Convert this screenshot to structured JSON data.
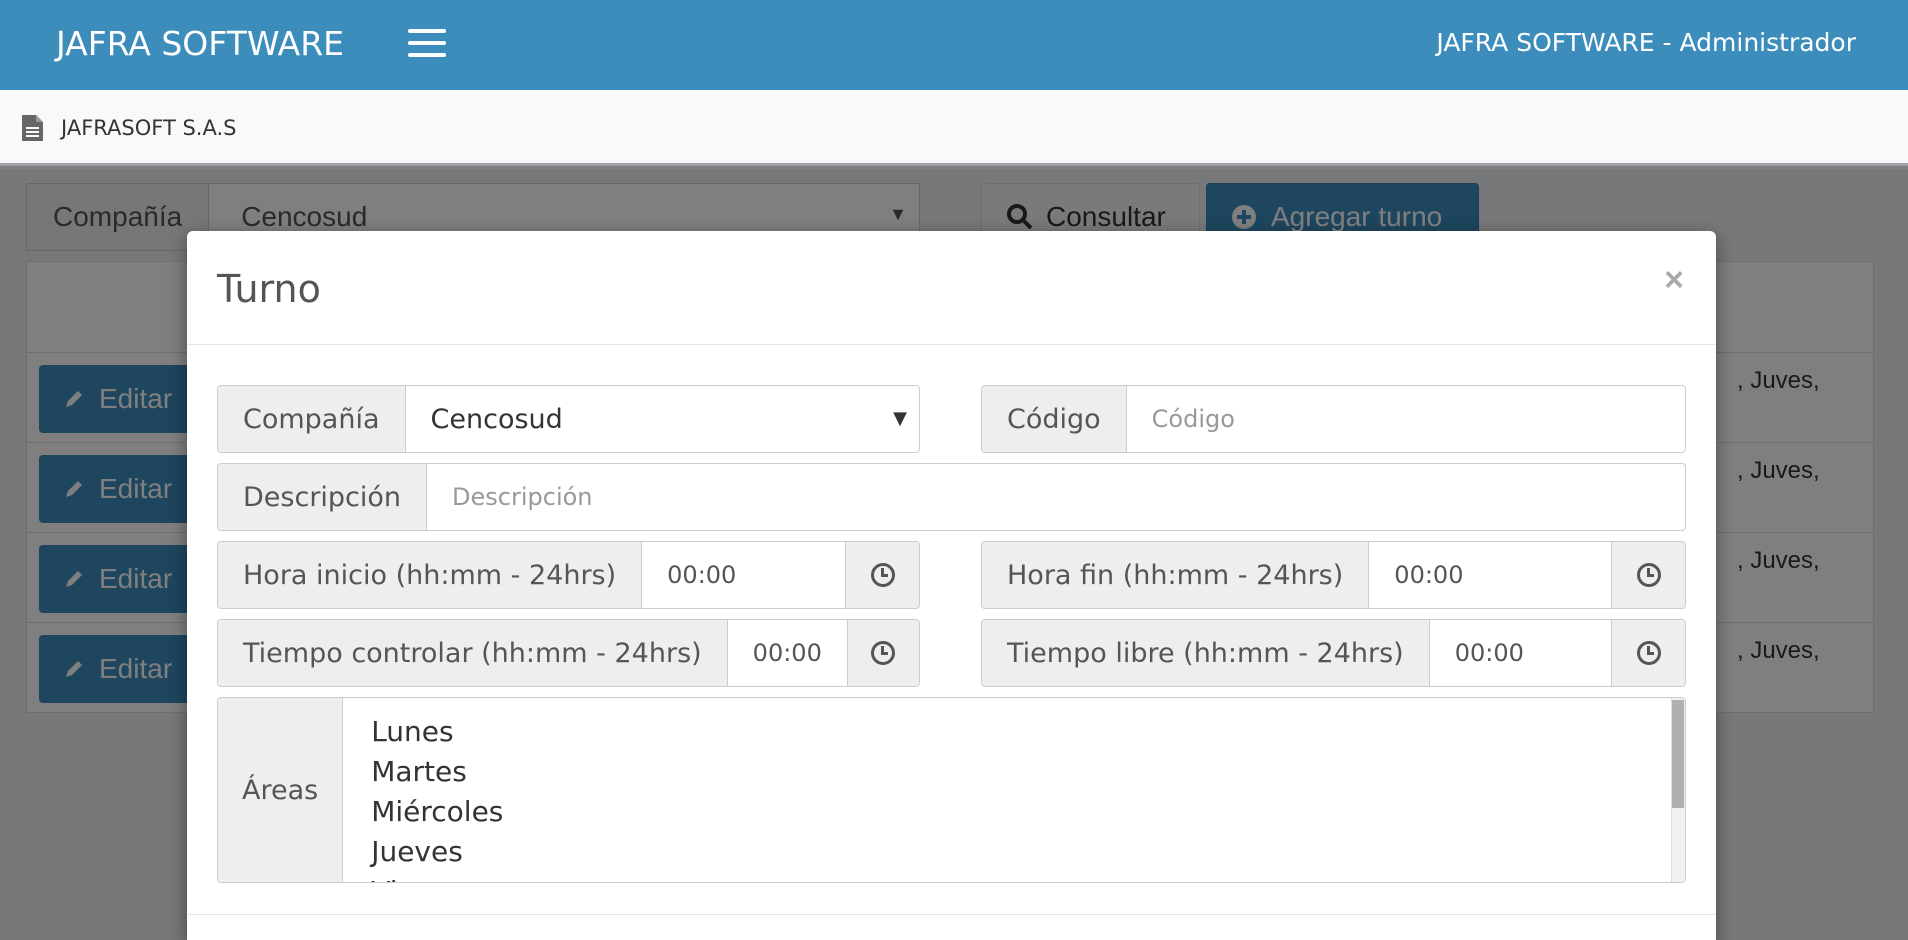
{
  "header": {
    "brand": "JAFRA SOFTWARE",
    "user_info": "JAFRA SOFTWARE  -  Administrador"
  },
  "subheader": {
    "company": "JAFRASOFT S.A.S"
  },
  "background": {
    "company_label": "Compañía",
    "company_value": "Cencosud",
    "consultar_label": "Consultar",
    "agregar_label": "Agregar turno",
    "rows": [
      {
        "edit_label": "Editar",
        "days": ", Juves,"
      },
      {
        "edit_label": "Editar",
        "days": ", Juves,"
      },
      {
        "edit_label": "Editar",
        "days": ", Juves,"
      },
      {
        "edit_label": "Editar",
        "days": ", Juves,"
      }
    ]
  },
  "modal": {
    "title": "Turno",
    "close": "×",
    "company_label": "Compañía",
    "company_value": "Cencosud",
    "codigo_label": "Código",
    "codigo_placeholder": "Código",
    "descripcion_label": "Descripción",
    "descripcion_placeholder": "Descripción",
    "hora_inicio_label": "Hora inicio (hh:mm - 24hrs)",
    "hora_inicio_value": "00:00",
    "hora_fin_label": "Hora fin (hh:mm - 24hrs)",
    "hora_fin_value": "00:00",
    "tiempo_controlar_label": "Tiempo controlar (hh:mm - 24hrs)",
    "tiempo_controlar_value": "00:00",
    "tiempo_libre_label": "Tiempo libre (hh:mm - 24hrs)",
    "tiempo_libre_value": "00:00",
    "areas_label": "Áreas",
    "areas_options": [
      "Lunes",
      "Martes",
      "Miércoles",
      "Jueves",
      "Vi..."
    ]
  },
  "colors": {
    "primary": "#3c8dbc",
    "addon_bg": "#eeeeee",
    "overlay": "rgba(0,0,0,0.5)"
  }
}
